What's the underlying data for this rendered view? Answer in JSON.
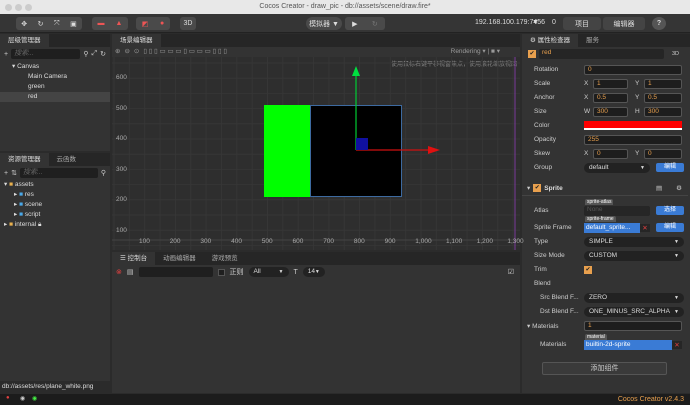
{
  "window": {
    "title": "Cocos Creator - draw_pic - db://assets/scene/draw.fire*"
  },
  "toolbar": {
    "btn_3d": "3D",
    "simulator": "模拟器 ▼",
    "ip": "192.168.100.179:7456",
    "wifi_count": "0",
    "project": "项目",
    "editor": "编辑器",
    "help": "?"
  },
  "hierarchy": {
    "tab": "层级管理器",
    "search_placeholder": "搜索...",
    "nodes": [
      "Canvas",
      "Main Camera",
      "green",
      "red"
    ]
  },
  "assets": {
    "tab": "资源管理器",
    "tab2": "云函数",
    "search_placeholder": "搜索...",
    "items": [
      "assets",
      "res",
      "scene",
      "script",
      "internal"
    ]
  },
  "scene": {
    "tab": "场景编辑器",
    "rendering": "Rendering",
    "hint": "使用鼠标右键平移视窗焦点，使用滚轮缩放视图",
    "y_ticks": [
      "600",
      "500",
      "400",
      "300",
      "200",
      "100"
    ],
    "x_ticks": [
      "100",
      "200",
      "300",
      "400",
      "500",
      "600",
      "700",
      "800",
      "900",
      "1,000",
      "1,100",
      "1,200",
      "1,300"
    ],
    "colors": {
      "green": "#00ff00",
      "black": "#000000"
    }
  },
  "console": {
    "tabs": [
      "控制台",
      "动画编辑器",
      "游戏预览"
    ],
    "regex": "正则",
    "level": "All",
    "font_size": "14"
  },
  "inspector": {
    "tab": "属性检查器",
    "tab2": "服务",
    "node_name": "red",
    "btn_3d": "3D",
    "rotation": {
      "label": "Rotation",
      "value": "0"
    },
    "scale": {
      "label": "Scale",
      "x": "1",
      "y": "1"
    },
    "anchor": {
      "label": "Anchor",
      "x": "0.5",
      "y": "0.5"
    },
    "size": {
      "label": "Size",
      "w": "300",
      "h": "300"
    },
    "color": {
      "label": "Color",
      "value": "#ff0000"
    },
    "opacity": {
      "label": "Opacity",
      "value": "255"
    },
    "skew": {
      "label": "Skew",
      "x": "0",
      "y": "0"
    },
    "group": {
      "label": "Group",
      "value": "default",
      "edit": "编辑"
    },
    "sprite": {
      "title": "Sprite",
      "atlas_label": "Atlas",
      "atlas_tag": "sprite-atlas",
      "atlas_value": "None",
      "atlas_btn": "选择",
      "frame_label": "Sprite Frame",
      "frame_tag": "sprite-frame",
      "frame_value": "default_sprite...",
      "frame_btn": "编辑",
      "type_label": "Type",
      "type_value": "SIMPLE",
      "size_mode_label": "Size Mode",
      "size_mode_value": "CUSTOM",
      "trim_label": "Trim",
      "blend_label": "Blend",
      "src_label": "Src Blend F...",
      "src_value": "ZERO",
      "dst_label": "Dst Blend F...",
      "dst_value": "ONE_MINUS_SRC_ALPHA",
      "materials_label": "Materials",
      "materials_count": "1",
      "material_item_label": "Materials",
      "material_tag": "material",
      "material_value": "builtin-2d-sprite"
    },
    "add_component": "添加组件"
  },
  "status": {
    "path": "db://assets/res/plane_white.png",
    "version": "Cocos Creator v2.4.3"
  }
}
